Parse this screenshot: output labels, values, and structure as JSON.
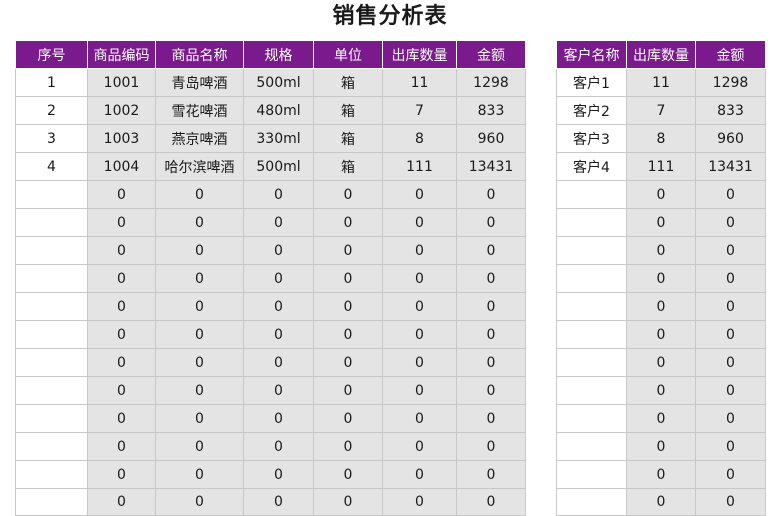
{
  "title": "销售分析表",
  "main_table": {
    "headers": [
      "序号",
      "商品编码",
      "商品名称",
      "规格",
      "单位",
      "出库数量",
      "金额"
    ],
    "rows": [
      [
        "1",
        "1001",
        "青岛啤酒",
        "500ml",
        "箱",
        "11",
        "1298"
      ],
      [
        "2",
        "1002",
        "雪花啤酒",
        "480ml",
        "箱",
        "7",
        "833"
      ],
      [
        "3",
        "1003",
        "燕京啤酒",
        "330ml",
        "箱",
        "8",
        "960"
      ],
      [
        "4",
        "1004",
        "哈尔滨啤酒",
        "500ml",
        "箱",
        "111",
        "13431"
      ],
      [
        "",
        "0",
        "0",
        "0",
        "0",
        "0",
        "0"
      ],
      [
        "",
        "0",
        "0",
        "0",
        "0",
        "0",
        "0"
      ],
      [
        "",
        "0",
        "0",
        "0",
        "0",
        "0",
        "0"
      ],
      [
        "",
        "0",
        "0",
        "0",
        "0",
        "0",
        "0"
      ],
      [
        "",
        "0",
        "0",
        "0",
        "0",
        "0",
        "0"
      ],
      [
        "",
        "0",
        "0",
        "0",
        "0",
        "0",
        "0"
      ],
      [
        "",
        "0",
        "0",
        "0",
        "0",
        "0",
        "0"
      ],
      [
        "",
        "0",
        "0",
        "0",
        "0",
        "0",
        "0"
      ],
      [
        "",
        "0",
        "0",
        "0",
        "0",
        "0",
        "0"
      ],
      [
        "",
        "0",
        "0",
        "0",
        "0",
        "0",
        "0"
      ],
      [
        "",
        "0",
        "0",
        "0",
        "0",
        "0",
        "0"
      ],
      [
        "",
        "0",
        "0",
        "0",
        "0",
        "0",
        "0"
      ]
    ]
  },
  "customer_table": {
    "headers": [
      "客户名称",
      "出库数量",
      "金额"
    ],
    "rows": [
      [
        "客户1",
        "11",
        "1298"
      ],
      [
        "客户2",
        "7",
        "833"
      ],
      [
        "客户3",
        "8",
        "960"
      ],
      [
        "客户4",
        "111",
        "13431"
      ],
      [
        "",
        "0",
        "0"
      ],
      [
        "",
        "0",
        "0"
      ],
      [
        "",
        "0",
        "0"
      ],
      [
        "",
        "0",
        "0"
      ],
      [
        "",
        "0",
        "0"
      ],
      [
        "",
        "0",
        "0"
      ],
      [
        "",
        "0",
        "0"
      ],
      [
        "",
        "0",
        "0"
      ],
      [
        "",
        "0",
        "0"
      ],
      [
        "",
        "0",
        "0"
      ],
      [
        "",
        "0",
        "0"
      ],
      [
        "",
        "0",
        "0"
      ]
    ]
  },
  "colors": {
    "header_bg": "#7a1a8c",
    "header_text": "#ffffff",
    "shaded_cell": "#e4e4e4",
    "grid_line": "#c8c8c8"
  }
}
